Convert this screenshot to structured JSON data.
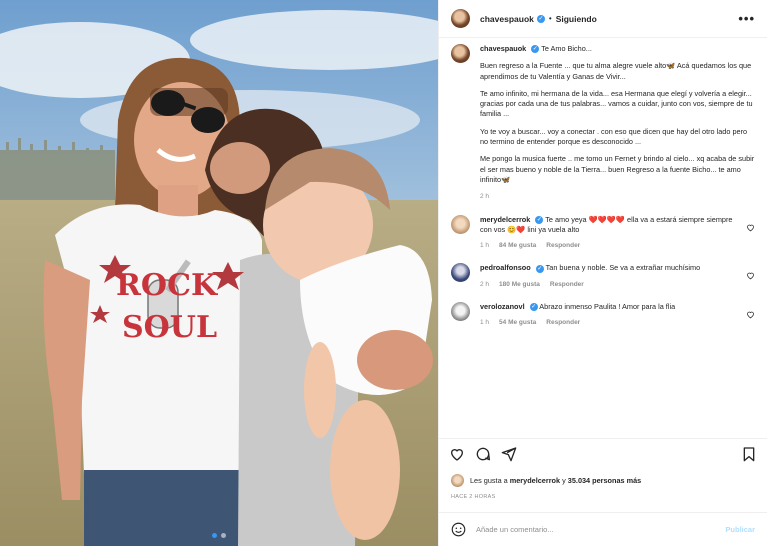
{
  "post": {
    "username": "chavespauok",
    "separator": "•",
    "follow_label": "Siguiendo",
    "more_label": "•••",
    "shirt_line1": "ROCK",
    "shirt_line2": "SOUL"
  },
  "caption": {
    "username": "chavespauok",
    "paragraphs": [
      "Te Amo Bicho...",
      "Buen regreso a la Fuente ... que tu alma alegre vuele alto🦋 Acá quedamos los que aprendimos de tu Valentía y Ganas de Vivir...",
      "Te amo infinito, mi hermana de la vida... esa Hermana que elegí y volvería a elegir... gracias por cada una de tus palabras... vamos a cuidar, junto con vos, siempre de tu familia ...",
      "Yo te voy a buscar... voy a conectar . con eso que dicen que hay del otro lado pero no termino de entender porque es desconocido ...",
      "Me pongo la musica fuerte .. me tomo un Fernet y brindo al cielo... xq acaba de subir el ser mas bueno y noble de la Tierra... buen Regreso a la fuente Bicho... te amo infinito🦋"
    ],
    "time": "2 h"
  },
  "comments": [
    {
      "username": "merydelcerrok",
      "text": "Te amo yeya ❤️❤️❤️❤️ ella va a estará siempre siempre con vos 😊❤️ lini ya vuela alto",
      "time": "1 h",
      "likes": "84 Me gusta",
      "reply": "Responder"
    },
    {
      "username": "pedroalfonsoo",
      "text": "Tan buena y noble. Se va a extrañar muchísimo",
      "time": "2 h",
      "likes": "180 Me gusta",
      "reply": "Responder"
    },
    {
      "username": "verolozanovl",
      "text": "Abrazo inmenso Paulita ! Amor para la flia",
      "time": "1 h",
      "likes": "54 Me gusta",
      "reply": "Responder"
    }
  ],
  "likes": {
    "prefix": "Les gusta a",
    "user": "merydelcerrok",
    "connector": "y",
    "count": "35.034 personas más"
  },
  "date": "HACE 2 HORAS",
  "add_comment": {
    "placeholder": "Añade un comentario...",
    "publish_label": "Publicar"
  },
  "colors": {
    "accent": "#3897f0",
    "muted": "#8e8e8e",
    "publish_disabled": "#b2dffc",
    "shirt_print": "#c8343c"
  },
  "icons": [
    "heart-icon",
    "comment-icon",
    "share-icon",
    "bookmark-icon",
    "emoji-icon",
    "more-icon",
    "verified-icon"
  ]
}
